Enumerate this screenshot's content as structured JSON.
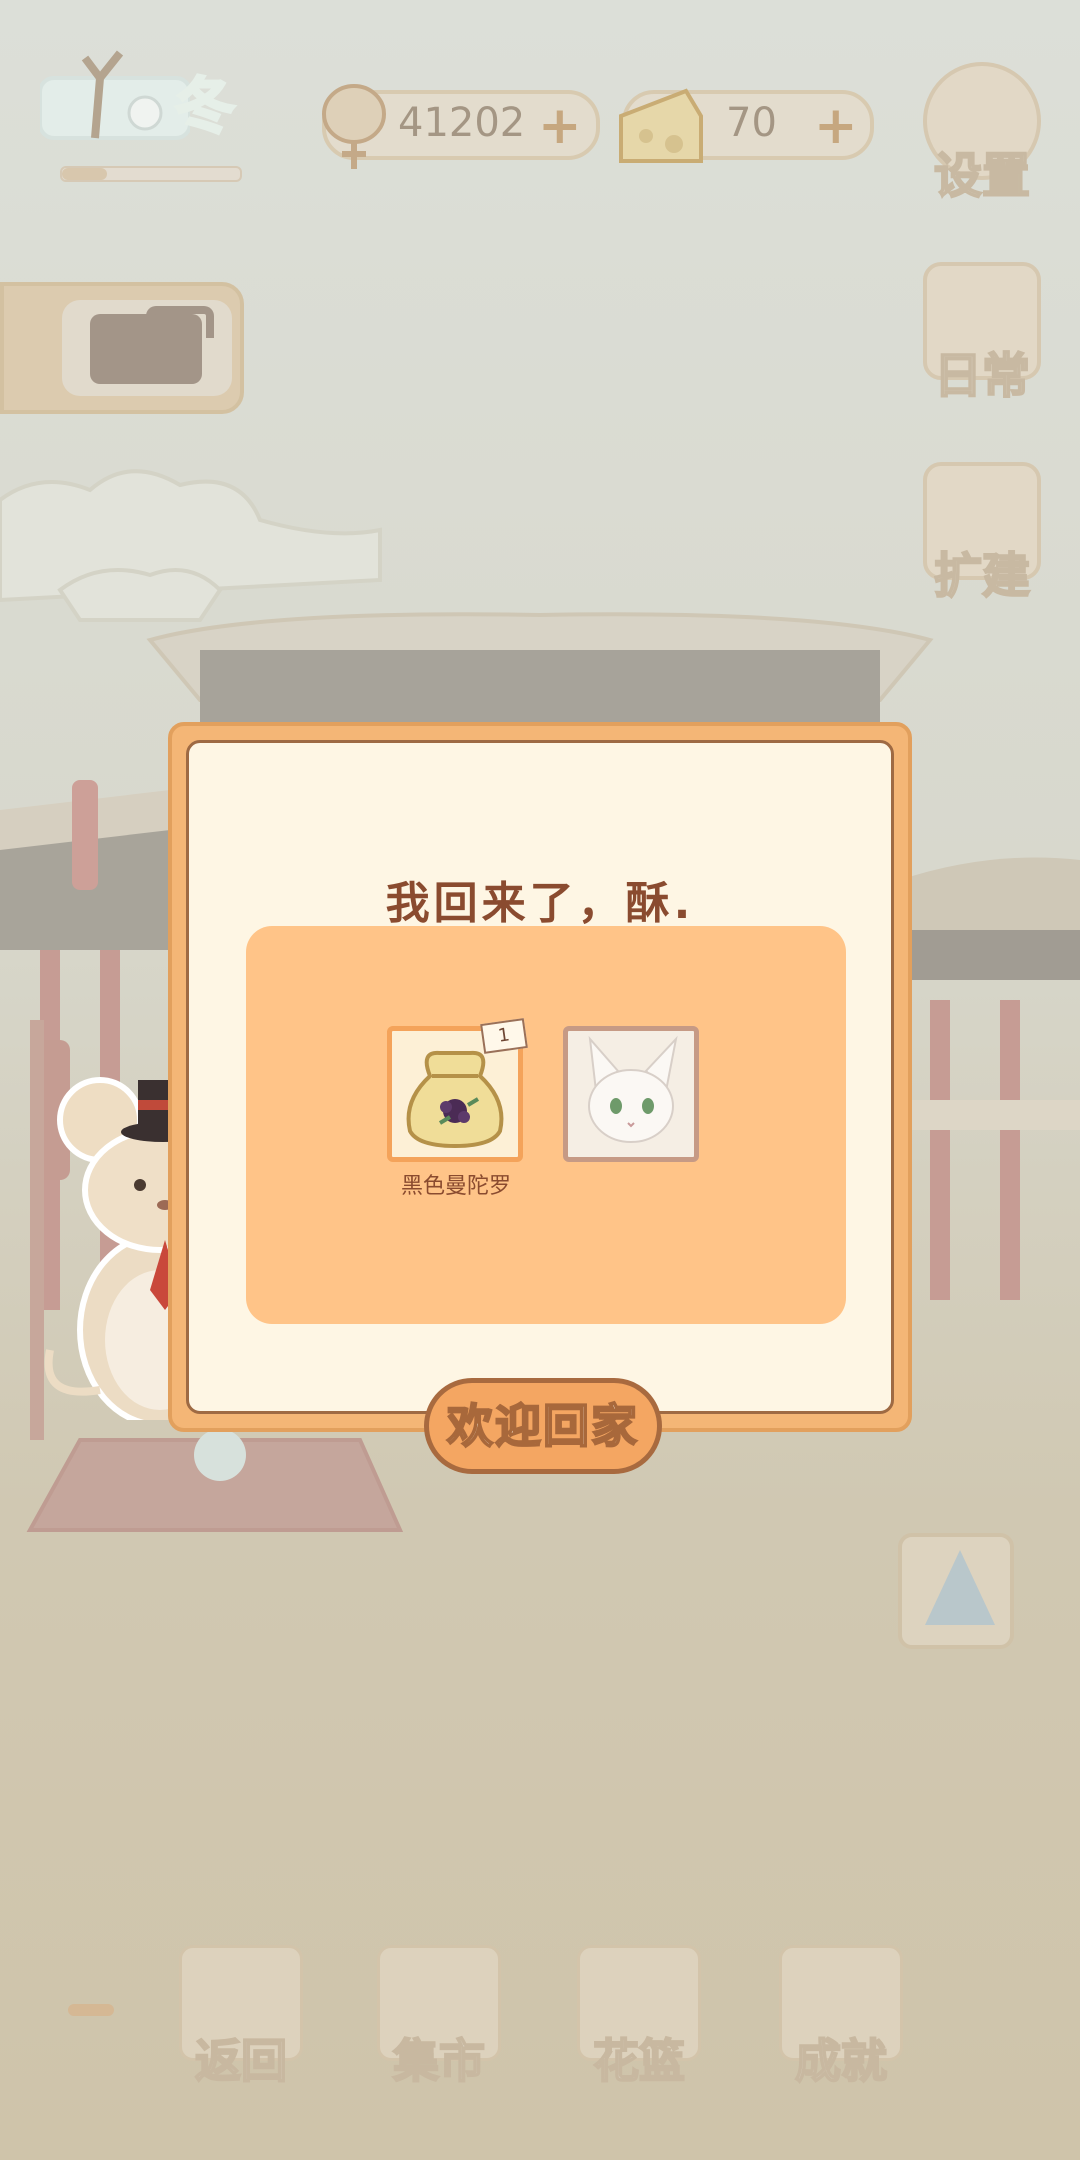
{
  "season": {
    "label": "冬",
    "progress": 0.25
  },
  "resources": {
    "fish": "41202",
    "cheese": "70",
    "add_symbol": "+"
  },
  "side_buttons": {
    "settings": "设置",
    "daily": "日常",
    "expand": "扩建"
  },
  "dialog": {
    "title": "我回来了，酥.",
    "reward_item": {
      "name": "黑色曼陀罗",
      "count": "1"
    },
    "confirm_label": "欢迎回家"
  },
  "bottom_nav": {
    "back": "返回",
    "market": "集市",
    "flower_basket": "花篮",
    "achievements": "成就"
  },
  "colors": {
    "dialog_frame": "#f4b676",
    "dialog_bg": "#fef6e4",
    "reward_panel": "#ffc488",
    "title_text": "#8a4b2f"
  }
}
